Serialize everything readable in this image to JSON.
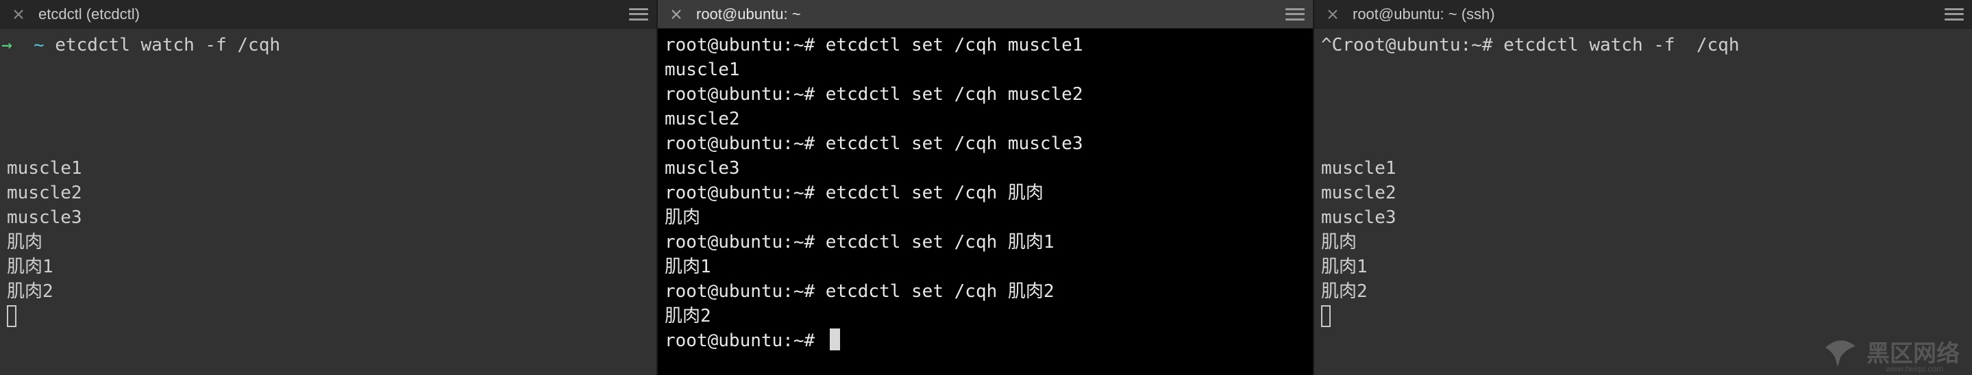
{
  "panes": {
    "left": {
      "tab_title": "etcdctl (etcdctl)",
      "prompt_arrow": "→",
      "prompt_tilde": "~",
      "command": "etcdctl watch -f /cqh",
      "outputs": [
        "muscle1",
        "muscle2",
        "muscle3",
        "肌肉",
        "肌肉1",
        "肌肉2"
      ]
    },
    "middle": {
      "tab_title": "root@ubuntu: ~",
      "lines": [
        "root@ubuntu:~# etcdctl set /cqh muscle1",
        "muscle1",
        "root@ubuntu:~# etcdctl set /cqh muscle2",
        "muscle2",
        "root@ubuntu:~# etcdctl set /cqh muscle3",
        "muscle3",
        "root@ubuntu:~# etcdctl set /cqh 肌肉",
        "肌肉",
        "root@ubuntu:~# etcdctl set /cqh 肌肉1",
        "肌肉1",
        "root@ubuntu:~# etcdctl set /cqh 肌肉2",
        "肌肉2"
      ],
      "current_prompt": "root@ubuntu:~# "
    },
    "right": {
      "tab_title": "root@ubuntu: ~ (ssh)",
      "command_line": "^Croot@ubuntu:~# etcdctl watch -f  /cqh",
      "outputs": [
        "muscle1",
        "muscle2",
        "muscle3",
        "肌肉",
        "肌肉1",
        "肌肉2"
      ]
    }
  },
  "watermark": {
    "text": "黑区网络",
    "sub": "www.heiqu.com"
  },
  "colors": {
    "prompt_arrow": "#5bd27d",
    "prompt_tilde": "#58c1d6",
    "terminal_bg_dark": "#000000",
    "terminal_bg_gray": "#323232"
  },
  "icons": {
    "tab_close": "close-icon",
    "tab_menu": "hamburger-menu-icon"
  }
}
